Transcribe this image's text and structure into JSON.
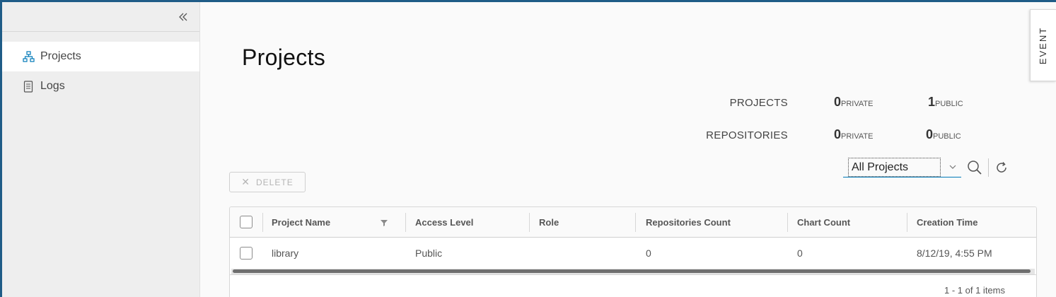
{
  "sidebar": {
    "collapse_icon": "double-chevron-left-icon",
    "items": [
      {
        "label": "Projects",
        "icon": "projects-icon",
        "active": true
      },
      {
        "label": "Logs",
        "icon": "logs-icon",
        "active": false
      }
    ]
  },
  "page": {
    "title": "Projects"
  },
  "summary": {
    "projects": {
      "label": "PROJECTS",
      "private_count": "0",
      "private_label": "PRIVATE",
      "public_count": "1",
      "public_label": "PUBLIC"
    },
    "repositories": {
      "label": "REPOSITORIES",
      "private_count": "0",
      "private_label": "PRIVATE",
      "public_count": "0",
      "public_label": "PUBLIC"
    }
  },
  "toolbar": {
    "delete_label": "DELETE",
    "filter_selected": "All Projects",
    "search_icon": "search-icon",
    "refresh_icon": "refresh-icon"
  },
  "table": {
    "columns": [
      "Project Name",
      "Access Level",
      "Role",
      "Repositories Count",
      "Chart Count",
      "Creation Time"
    ],
    "rows": [
      {
        "project_name": "library",
        "access_level": "Public",
        "role": "",
        "repositories_count": "0",
        "chart_count": "0",
        "creation_time": "8/12/19, 4:55 PM"
      }
    ],
    "footer": "1 - 1 of 1 items"
  },
  "event_tab": {
    "label": "EVENT"
  },
  "colors": {
    "accent": "#0079b8",
    "frame": "#1f5c87"
  }
}
